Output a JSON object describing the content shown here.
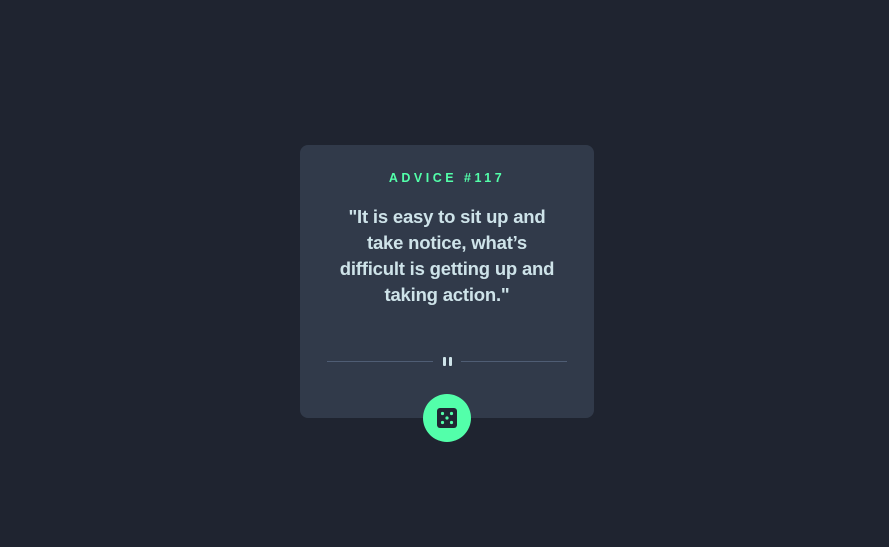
{
  "advice": {
    "label": "ADVICE #117",
    "quote": "\"It is easy to sit up and take notice, what’s difficult is getting up and taking action.\""
  },
  "icons": {
    "divider": "pause-icon",
    "button": "dice-icon"
  },
  "colors": {
    "background": "#1f2430",
    "card": "#313a4a",
    "accent": "#53ffaa",
    "text": "#cee3e9",
    "divider": "#4f5d74"
  }
}
